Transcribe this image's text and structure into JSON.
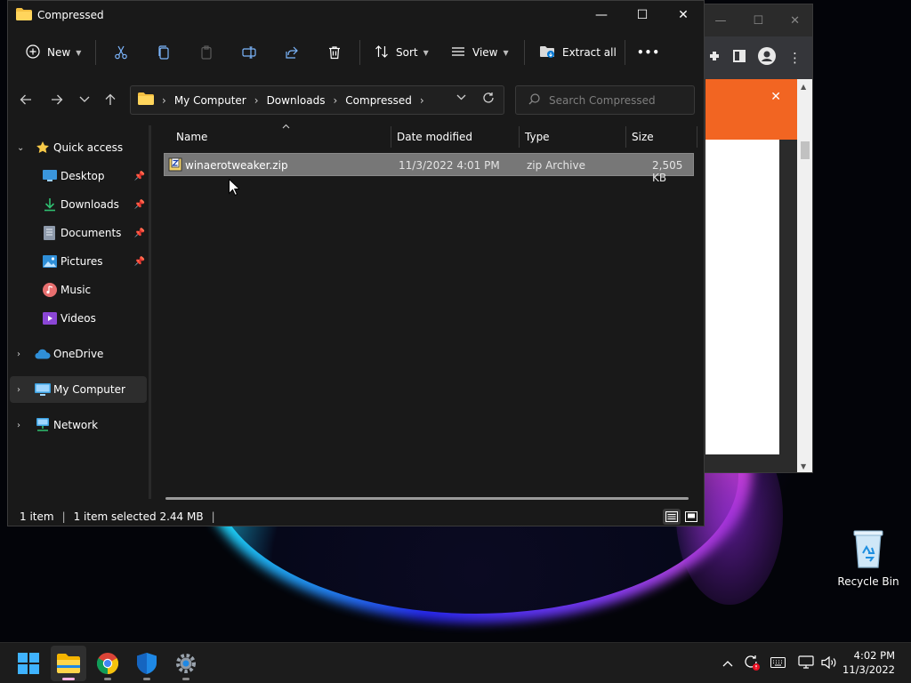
{
  "window": {
    "title": "Compressed",
    "controls": {
      "minimize": "—",
      "maximize": "☐",
      "close": "✕"
    }
  },
  "toolbar": {
    "new_label": "New",
    "sort_label": "Sort",
    "view_label": "View",
    "extract_label": "Extract all",
    "more_label": "•••",
    "icons": [
      "cut-icon",
      "copy-icon",
      "paste-icon",
      "rename-icon",
      "share-icon",
      "delete-icon"
    ]
  },
  "address": {
    "crumbs": [
      "My Computer",
      "Downloads",
      "Compressed"
    ]
  },
  "search": {
    "placeholder": "Search Compressed"
  },
  "nav": {
    "quick_access": "Quick access",
    "items": [
      {
        "label": "Desktop",
        "icon": "desktop-icon",
        "pinned": true
      },
      {
        "label": "Downloads",
        "icon": "downloads-icon",
        "pinned": true
      },
      {
        "label": "Documents",
        "icon": "documents-icon",
        "pinned": true
      },
      {
        "label": "Pictures",
        "icon": "pictures-icon",
        "pinned": true
      },
      {
        "label": "Music",
        "icon": "music-icon",
        "pinned": false
      },
      {
        "label": "Videos",
        "icon": "videos-icon",
        "pinned": false
      }
    ],
    "onedrive": "OneDrive",
    "mycomputer": "My Computer",
    "network": "Network"
  },
  "columns": {
    "name": "Name",
    "date": "Date modified",
    "type": "Type",
    "size": "Size"
  },
  "files": [
    {
      "name": "winaerotweaker.zip",
      "date": "11/3/2022 4:01 PM",
      "type": "zip Archive",
      "size": "2,505 KB",
      "selected": true
    }
  ],
  "status": {
    "count": "1 item",
    "selection": "1 item selected  2.44 MB"
  },
  "desktop": {
    "recycle_bin": "Recycle Bin"
  },
  "taskbar": {
    "apps": [
      "start-icon",
      "file-explorer-icon",
      "chrome-icon",
      "defender-icon",
      "settings-icon"
    ],
    "time": "4:02 PM",
    "date": "11/3/2022"
  },
  "colors": {
    "accent": "#0078d4",
    "selection": "#777777",
    "window_bg": "#191919",
    "banner": "#f26522"
  }
}
